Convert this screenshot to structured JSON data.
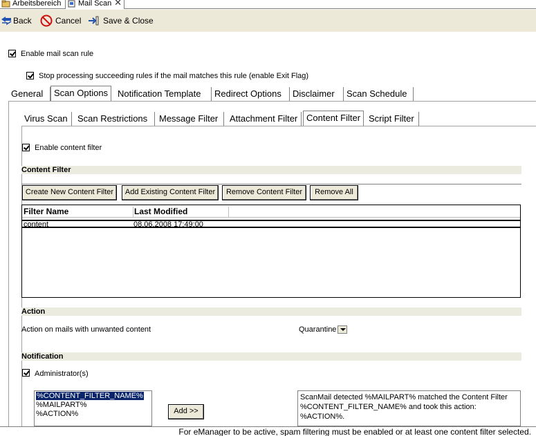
{
  "doc_tabs": [
    {
      "label": "Arbeitsbereich",
      "icon": "workspace-icon"
    },
    {
      "label": "Mail Scan",
      "icon": "mail-scan-icon"
    }
  ],
  "toolbar": {
    "back_label": "Back",
    "cancel_label": "Cancel",
    "save_close_label": "Save & Close"
  },
  "rule": {
    "enable_label": "Enable mail scan rule",
    "exit_flag_label": "Stop processing succeeding rules if the mail matches this rule (enable Exit Flag)"
  },
  "main_tabs": [
    {
      "label": "General"
    },
    {
      "label": "Scan Options"
    },
    {
      "label": "Notification Template"
    },
    {
      "label": "Redirect Options"
    },
    {
      "label": "Disclaimer"
    },
    {
      "label": "Scan Schedule"
    }
  ],
  "sub_tabs": [
    {
      "label": "Virus Scan"
    },
    {
      "label": "Scan Restrictions"
    },
    {
      "label": "Message Filter"
    },
    {
      "label": "Attachment Filter"
    },
    {
      "label": "Content Filter"
    },
    {
      "label": "Script Filter"
    }
  ],
  "content_filter": {
    "enable_label": "Enable content filter",
    "section_title": "Content Filter",
    "buttons": {
      "create": "Create New Content Filter",
      "add_existing": "Add Existing Content Filter",
      "remove": "Remove Content Filter",
      "remove_all": "Remove All"
    },
    "columns": [
      "Filter Name",
      "Last Modified"
    ],
    "rows": [
      {
        "name": "content",
        "modified": "08.06.2008 17:49:00"
      }
    ]
  },
  "action": {
    "section_title": "Action",
    "label": "Action on mails with unwanted content",
    "value": "Quarantine"
  },
  "notification": {
    "section_title": "Notification",
    "admin_label": "Administrator(s)",
    "variables": [
      "%CONTENT_FILTER_NAME%",
      "%MAILPART%",
      "%ACTION%"
    ],
    "add_button": "Add >>",
    "message": "ScanMail detected %MAILPART% matched the Content Filter %CONTENT_FILTER_NAME% and took this action: %ACTION%."
  },
  "status": {
    "text": "For eManager to be active, spam filtering must be enabled or at least one content filter selected."
  }
}
